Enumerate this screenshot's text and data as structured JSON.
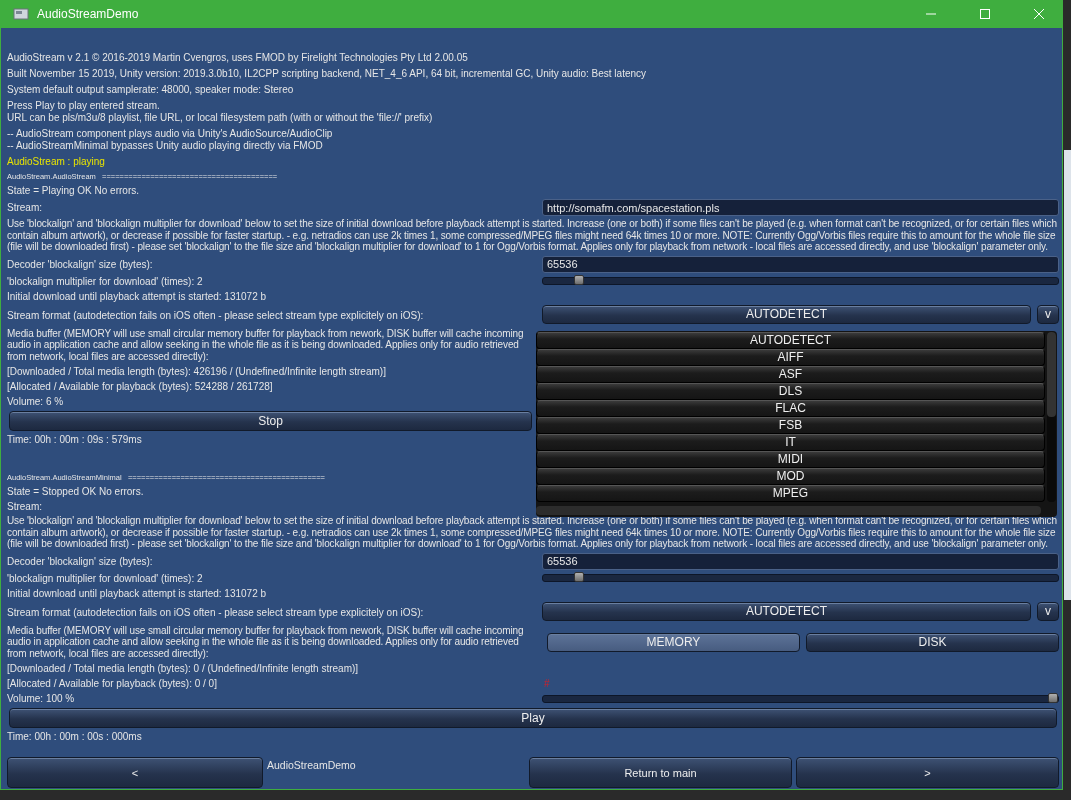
{
  "window": {
    "title": "AudioStreamDemo"
  },
  "info_lines": [
    "AudioStream v 2.1 © 2016-2019 Martin Cvengros, uses FMOD by Firelight Technologies Pty Ltd 2.00.05",
    "Built November 15 2019, Unity version: 2019.3.0b10, IL2CPP scripting backend, NET_4_6 API, 64 bit, incremental GC,  Unity audio: Best latency",
    "System default output samplerate: 48000, speaker mode: Stereo",
    "Press Play to play entered stream.\nURL can be pls/m3u/8 playlist, file URL, or local filesystem path (with or without the 'file://' prefix)",
    "-- AudioStream component plays audio via Unity's AudioSource/AudioClip\n-- AudioStreamMinimal bypasses Unity audio playing directly via FMOD"
  ],
  "status": "AudioStream : playing",
  "sections": [
    {
      "header": "AudioStream.AudioStream   ========================================",
      "state": "State = Playing OK No errors.",
      "stream_label": "Stream:",
      "stream_url": "http://somafm.com/spacestation.pls",
      "blockalign_note": "Use 'blockalign' and 'blockalign multiplier for download' below to set the size of initial download before playback attempt is started. Increase (one or both) if some files can't be played (e.g. when format can't be recognized, or for certain files which contain album artwork), or decrease if possible for faster startup. - e.g. netradios can use 2k times 1, some compressed/MPEG files might need 64k times 10 or more. NOTE: Currently Ogg/Vorbis files require this to amount for the whole file size (file will be downloaded first) - please set 'blockalign' to the file size and 'blockalign multiplier for download' to 1 for Ogg/Vorbis format. Applies only for playback from network - local files are accessed directly, and use 'blockalign' parameter only.",
      "decoder_label": "Decoder 'blockalign' size (bytes):",
      "decoder_value": "65536",
      "multiplier_label": "'blockalign multiplier for download' (times): 2",
      "multiplier": {
        "level": 0.07
      },
      "initial_download": "Initial download until playback attempt is started: 131072 b",
      "format_label": "Stream format (autodetection fails on iOS often - please select stream type explicitely on iOS):",
      "format_value": "AUTODETECT",
      "format_toggle": "v",
      "media_buffer_note": "Media buffer (MEMORY will use small circular memory buffer for playback from nework, DISK buffer will cache incoming audio in application cache and allow seeking in the whole file as it is being downloaded. Applies only for audio retrieved from network, local files are accessed directly):",
      "downloaded": "[Downloaded / Total media length (bytes): 426196 / (Undefined/Infinite length stream)]",
      "allocated": "[Allocated / Available for playback (bytes): 524288 / 261728]",
      "volume_label": "Volume: 6 %",
      "action": "Stop",
      "time": "Time: 00h : 00m : 09s : 579ms"
    },
    {
      "header": "AudioStream.AudioStreamMinimal   =============================================",
      "state": "State = Stopped OK No errors.",
      "stream_label": "Stream:",
      "blockalign_note": "Use 'blockalign' and 'blockalign multiplier for download' below to set the size of initial download before playback attempt is started. Increase (one or both) if some files can't be played (e.g. when format can't be recognized, or for certain files which contain album artwork), or decrease if possible for faster startup. - e.g. netradios can use 2k times 1, some compressed/MPEG files might need 64k times 10 or more. NOTE: Currently Ogg/Vorbis files require this to amount for the whole file size (file will be downloaded first) - please set 'blockalign' to the file size and 'blockalign multiplier for download' to 1 for Ogg/Vorbis format. Applies only for playback from network - local files are accessed directly, and use 'blockalign' parameter only.",
      "decoder_label": "Decoder 'blockalign' size (bytes):",
      "decoder_value": "65536",
      "multiplier_label": "'blockalign multiplier for download' (times): 2",
      "multiplier": {
        "level": 0.07
      },
      "initial_download": "Initial download until playback attempt is started: 131072 b",
      "format_label": "Stream format (autodetection fails on iOS often - please select stream type explicitely on iOS):",
      "format_value": "AUTODETECT",
      "format_toggle": "v",
      "media_buffer_note": "Media buffer (MEMORY will use small circular memory buffer for playback from nework, DISK buffer will cache incoming audio in application cache and allow seeking in the whole file as it is being downloaded. Applies only for audio retrieved from network, local files are accessed directly):",
      "buffer_options": [
        {
          "label": "MEMORY",
          "selected": true
        },
        {
          "label": "DISK",
          "selected": false
        }
      ],
      "downloaded": "[Downloaded / Total media length (bytes): 0 / (Undefined/Infinite length stream)]",
      "allocated": "[Allocated / Available for playback (bytes): 0 / 0]",
      "marker": "#",
      "volume_label": "Volume: 100 %",
      "volume": {
        "level": 1.0
      },
      "action": "Play",
      "time": "Time: 00h : 00m : 00s : 000ms"
    }
  ],
  "format_dropdown": {
    "options": [
      "AUTODETECT",
      "AIFF",
      "ASF",
      "DLS",
      "FLAC",
      "FSB",
      "IT",
      "MIDI",
      "MOD",
      "MPEG"
    ]
  },
  "bottom_bar": {
    "prev": "<",
    "title": "AudioStreamDemo",
    "return": "Return to main",
    "next": ">"
  }
}
